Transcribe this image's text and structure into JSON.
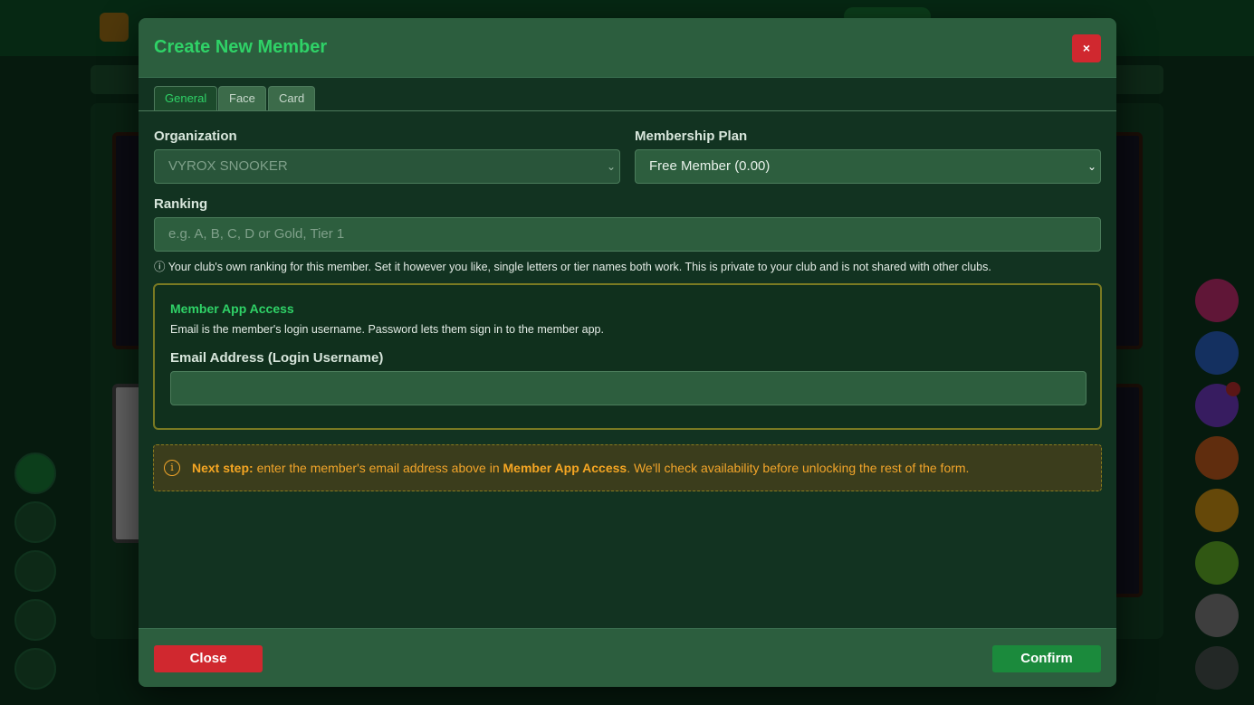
{
  "modal": {
    "title": "Create New Member",
    "close_icon_glyph": "×"
  },
  "tabs": [
    {
      "label": "General",
      "active": true
    },
    {
      "label": "Face",
      "active": false
    },
    {
      "label": "Card",
      "active": false
    }
  ],
  "form": {
    "organization": {
      "label": "Organization",
      "value": "VYROX SNOOKER",
      "disabled": true
    },
    "membership_plan": {
      "label": "Membership Plan",
      "value": "Free Member (0.00)"
    },
    "ranking": {
      "label": "Ranking",
      "placeholder": "e.g. A, B, C, D or Gold, Tier 1",
      "help": "ⓘ Your club's own ranking for this member. Set it however you like, single letters or tier names both work. This is private to your club and is not shared with other clubs."
    }
  },
  "member_app_access": {
    "title": "Member App Access",
    "description": "Email is the member's login username. Password lets them sign in to the member app.",
    "email_label": "Email Address (Login Username)",
    "email_value": ""
  },
  "notice": {
    "icon": "info-icon",
    "icon_glyph": "i",
    "lead": "Next step:",
    "text_before": " enter the member's email address above in ",
    "highlight": "Member App Access",
    "text_after": ". We'll check availability before unlocking the rest of the form."
  },
  "footer": {
    "close_label": "Close",
    "confirm_label": "Confirm"
  },
  "colors": {
    "accent_green": "#2fd267",
    "danger_red": "#d0282f",
    "confirm_green": "#1b8a3c",
    "warning_amber": "#f2a52a"
  }
}
